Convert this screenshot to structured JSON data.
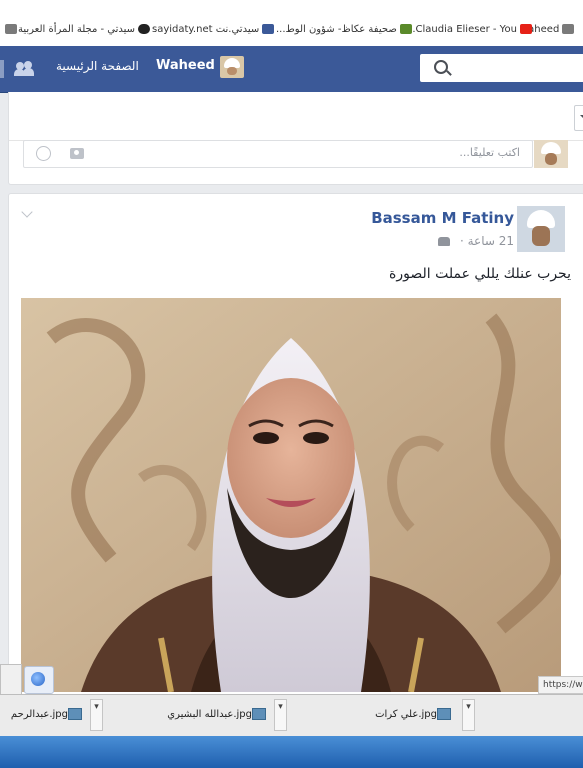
{
  "bookmarks": [
    {
      "label": "waheed",
      "icon": "generic-icon"
    },
    {
      "label": "Claudia Elieser - You...",
      "icon": "youtube-icon"
    },
    {
      "label": "صحيفة عكاظ- شؤون الوط...",
      "icon": "okaz-icon"
    },
    {
      "label": "سيدتي.نت sayidaty.net",
      "icon": "facebook-icon"
    },
    {
      "label": "سيدتي - مجلة المرأة العربية",
      "icon": "bird-icon"
    },
    {
      "label": "",
      "icon": "generic-icon"
    }
  ],
  "fb_nav": {
    "user_name": "Waheed",
    "home_label": "الصفحة الرئيسية"
  },
  "previous_post": {
    "comment_placeholder": "اكتب تعليقًا..."
  },
  "post": {
    "author": "Bassam M Fatiny",
    "time": "21 ساعة",
    "separator": "·",
    "text": "يحرب عنلك يللي عملت الصورة"
  },
  "status_url": "https://w",
  "downloads": [
    {
      "name": "jpg.علي كرات"
    },
    {
      "name": "jpg.عبدالله البشيري"
    },
    {
      "name": "jpg.عبدالرحم"
    }
  ],
  "colors": {
    "fb_blue": "#3b5998",
    "link_blue": "#365899"
  }
}
